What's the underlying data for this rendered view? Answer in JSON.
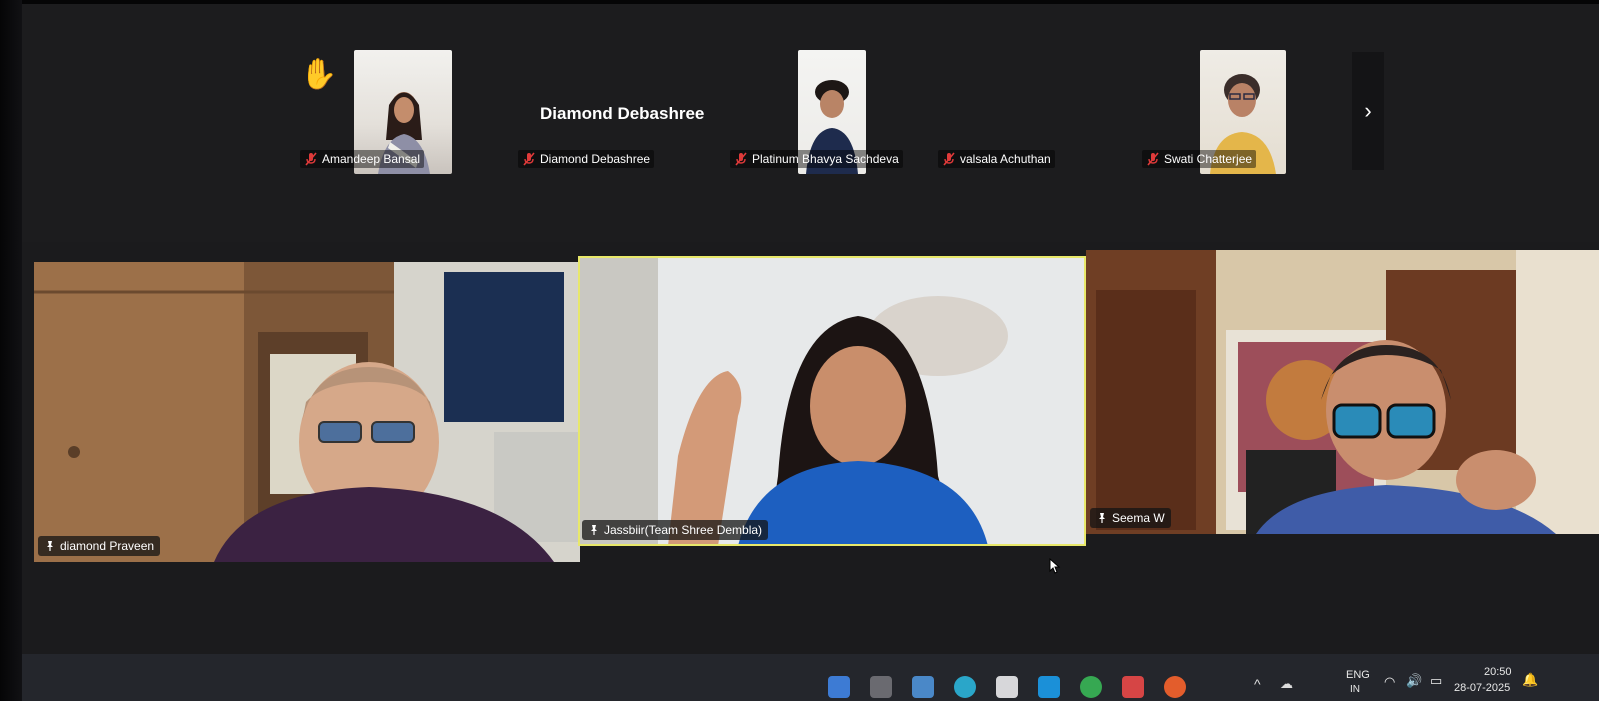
{
  "thumbnails": [
    {
      "name": "Amandeep Bansal",
      "muted": true,
      "hand_raised": true
    },
    {
      "name": "Diamond Debashree",
      "muted": true,
      "video_off": true
    },
    {
      "name": "Platinum Bhavya Sachdeva",
      "muted": true
    },
    {
      "name": "valsala Achuthan",
      "muted": true,
      "video_off": true
    },
    {
      "name": "Swati Chatterjee",
      "muted": true
    }
  ],
  "featured_name_text": "Diamond Debashree",
  "main_tiles": [
    {
      "name": "diamond Praveen",
      "pinned": true
    },
    {
      "name": "Jassbiir(Team Shree Dembla)",
      "pinned": true,
      "active_speaker": true
    },
    {
      "name": "Seema W",
      "pinned": true
    }
  ],
  "icons": {
    "hand": "raised-hand-icon",
    "muted": "mic-muted-icon",
    "pin": "pin-icon",
    "next": "chevron-right-icon"
  },
  "next_label": "›",
  "tray": {
    "lang": "ENG",
    "region": "IN",
    "time": "20:50",
    "date": "28-07-2025"
  },
  "colors": {
    "muted_icon": "#e03a3a",
    "active_border": "#e8e86a",
    "hand": "#f4b43b"
  }
}
